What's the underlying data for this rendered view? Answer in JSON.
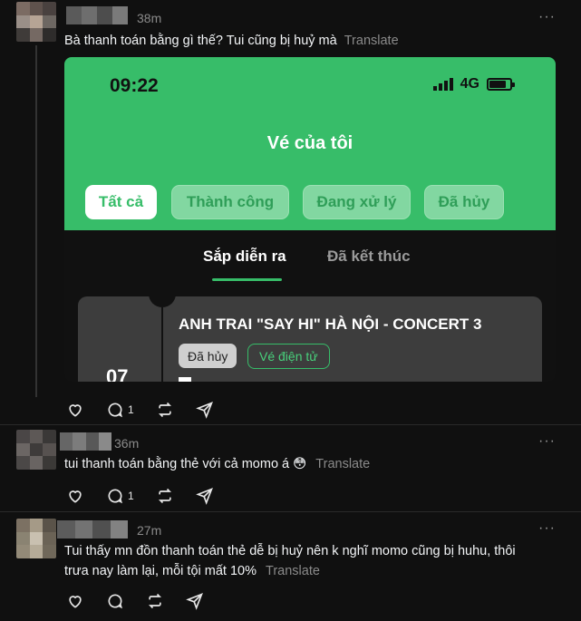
{
  "posts": [
    {
      "time": "38m",
      "text": "Bà thanh toán bằng gì thế? Tui cũng bị huỷ mà",
      "translate": "Translate",
      "reply_count": "1",
      "avatar_colors": [
        "#7b6b63",
        "#5f524d",
        "#49413f",
        "#9a8f88",
        "#b6a495",
        "#6d6762",
        "#3f3b39",
        "#756963",
        "#2e2c2b"
      ],
      "name_blur_colors": [
        "#5a5a5a",
        "#6e6e6e",
        "#4d4d4d",
        "#7a7a7a"
      ]
    },
    {
      "time": "36m",
      "text": "tui thanh toán bằng thẻ với cả momo á 😳",
      "translate": "Translate",
      "reply_count": "1",
      "avatar_colors": [
        "#4a4646",
        "#5d5856",
        "#3a3837",
        "#6b6664",
        "#3e3b3a",
        "#575250",
        "#4b4847",
        "#696462",
        "#3b3937"
      ],
      "name_blur_colors": [
        "#666",
        "#7c7c7c",
        "#585858",
        "#8a8a8a"
      ]
    },
    {
      "time": "27m",
      "text_line1": "Tui thấy mn đồn thanh toán thẻ dễ bị huỷ nên k nghĩ momo cũng bị huhu, thôi",
      "text_line2": "trưa nay làm lại, mỗi tội mất 10%",
      "translate": "Translate",
      "reply_count": "",
      "avatar_colors": [
        "#7c7163",
        "#a59a87",
        "#5a5349",
        "#8a8372",
        "#c9c0b0",
        "#6b6356",
        "#938a78",
        "#b5ab98",
        "#70685a"
      ],
      "name_blur_colors": [
        "#5c5c5c",
        "#737373",
        "#505050",
        "#828282"
      ]
    }
  ],
  "ticket_app": {
    "status_time": "09:22",
    "network": "4G",
    "title": "Vé của tôi",
    "filters": [
      "Tất cả",
      "Thành công",
      "Đang xử lý",
      "Đã hủy"
    ],
    "subtabs": [
      "Sắp diễn ra",
      "Đã kết thúc"
    ],
    "event_title": "ANH TRAI \"SAY HI\" HÀ NỘI - CONCERT 3",
    "status_tag": "Đã hủy",
    "ticket_type_tag": "Vé điện tử",
    "date_day": "07"
  },
  "more_label": "···",
  "colors": {
    "background": "#101010",
    "accent_green": "#37bd69",
    "muted": "#8a8a8a"
  }
}
